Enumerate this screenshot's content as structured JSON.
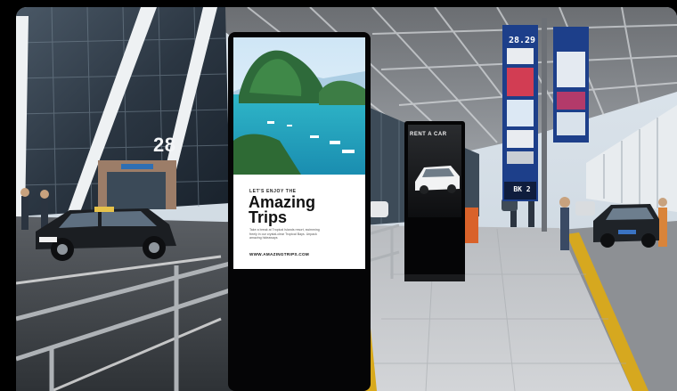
{
  "terminal": {
    "gate_number": "28"
  },
  "kiosk_main": {
    "eyebrow": "LET'S ENJOY THE",
    "headline_line1": "Amazing",
    "headline_line2": "Trips",
    "body": "Take a break at Tropical Islands resort, swimming freely in our crystal-clear Tropical Bays. Unpack amazing hideaways",
    "website": "WWW.AMAZINGTRIPS.COM"
  },
  "kiosk_small": {
    "headline": "RENT A CAR"
  },
  "departure_board": {
    "time_display": "28.29",
    "gate_code": "BK 2"
  },
  "colors": {
    "board_blue": "#1d3f8a",
    "ad_white": "#ffffff",
    "ad_headline": "#111111",
    "platform_gray": "#c9ccd0",
    "kiosk_black": "#050506"
  }
}
